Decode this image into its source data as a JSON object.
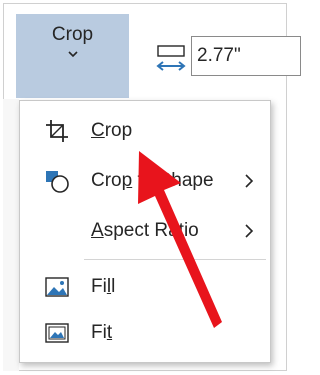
{
  "ribbon": {
    "crop_button": {
      "label": "Crop",
      "dropdown_icon": "chevron-down-icon"
    },
    "width_field": {
      "icon": "shape-width-icon",
      "value": "2.77\""
    }
  },
  "menu": {
    "items": [
      {
        "key": "crop",
        "label_prefix": "",
        "label_accel": "C",
        "label_suffix": "rop",
        "icon": "crop-icon",
        "has_submenu": false
      },
      {
        "key": "crop_to_shape",
        "label_prefix": "Cro",
        "label_accel": "p",
        "label_suffix": " to Shape",
        "icon": "crop-to-shape-icon",
        "has_submenu": true
      },
      {
        "key": "aspect_ratio",
        "label_prefix": "",
        "label_accel": "A",
        "label_suffix": "spect Ratio",
        "icon": "",
        "has_submenu": true
      },
      {
        "key": "fill",
        "label_prefix": "Fi",
        "label_accel": "l",
        "label_suffix": "l",
        "icon": "fill-picture-icon",
        "has_submenu": false
      },
      {
        "key": "fit",
        "label_prefix": "Fi",
        "label_accel": "t",
        "label_suffix": "",
        "icon": "fit-picture-icon",
        "has_submenu": false
      }
    ]
  },
  "annotation": {
    "type": "arrow",
    "color": "#e8141c",
    "points_to": "Crop"
  },
  "colors": {
    "crop_button_bg": "#b9cbe0",
    "accent_blue": "#2e75b6",
    "ribbon_bg": "#f3f3f3"
  }
}
